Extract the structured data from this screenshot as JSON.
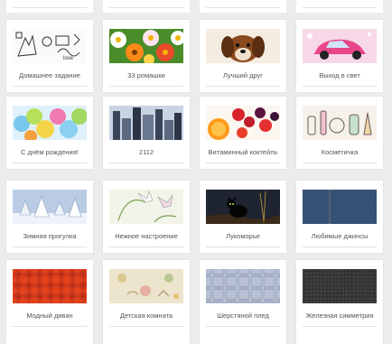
{
  "themes": [
    {
      "label": "Домашнее задание",
      "icon": "doodle-homework-thumbnail"
    },
    {
      "label": "33 ромашки",
      "icon": "daisies-thumbnail"
    },
    {
      "label": "Лучший друг",
      "icon": "dog-thumbnail"
    },
    {
      "label": "Выход в свет",
      "icon": "pink-car-thumbnail"
    },
    {
      "label": "С днём рождения!",
      "icon": "balloons-thumbnail"
    },
    {
      "label": "2112",
      "icon": "city-skyline-thumbnail"
    },
    {
      "label": "Витаминный коктейль",
      "icon": "fruits-thumbnail"
    },
    {
      "label": "Косметичка",
      "icon": "cosmetics-thumbnail"
    },
    {
      "label": "Зимняя прогулка",
      "icon": "winter-forest-thumbnail"
    },
    {
      "label": "Нежное настроение",
      "icon": "lilies-thumbnail"
    },
    {
      "label": "Лукоморье",
      "icon": "black-cat-thumbnail"
    },
    {
      "label": "Любимые джинсы",
      "icon": "denim-thumbnail"
    },
    {
      "label": "Модный диван",
      "icon": "red-sofa-thumbnail"
    },
    {
      "label": "Детская комната",
      "icon": "kids-room-thumbnail"
    },
    {
      "label": "Шерстяной плед",
      "icon": "plaid-thumbnail"
    },
    {
      "label": "Железная симметрия",
      "icon": "metal-mesh-thumbnail"
    }
  ]
}
